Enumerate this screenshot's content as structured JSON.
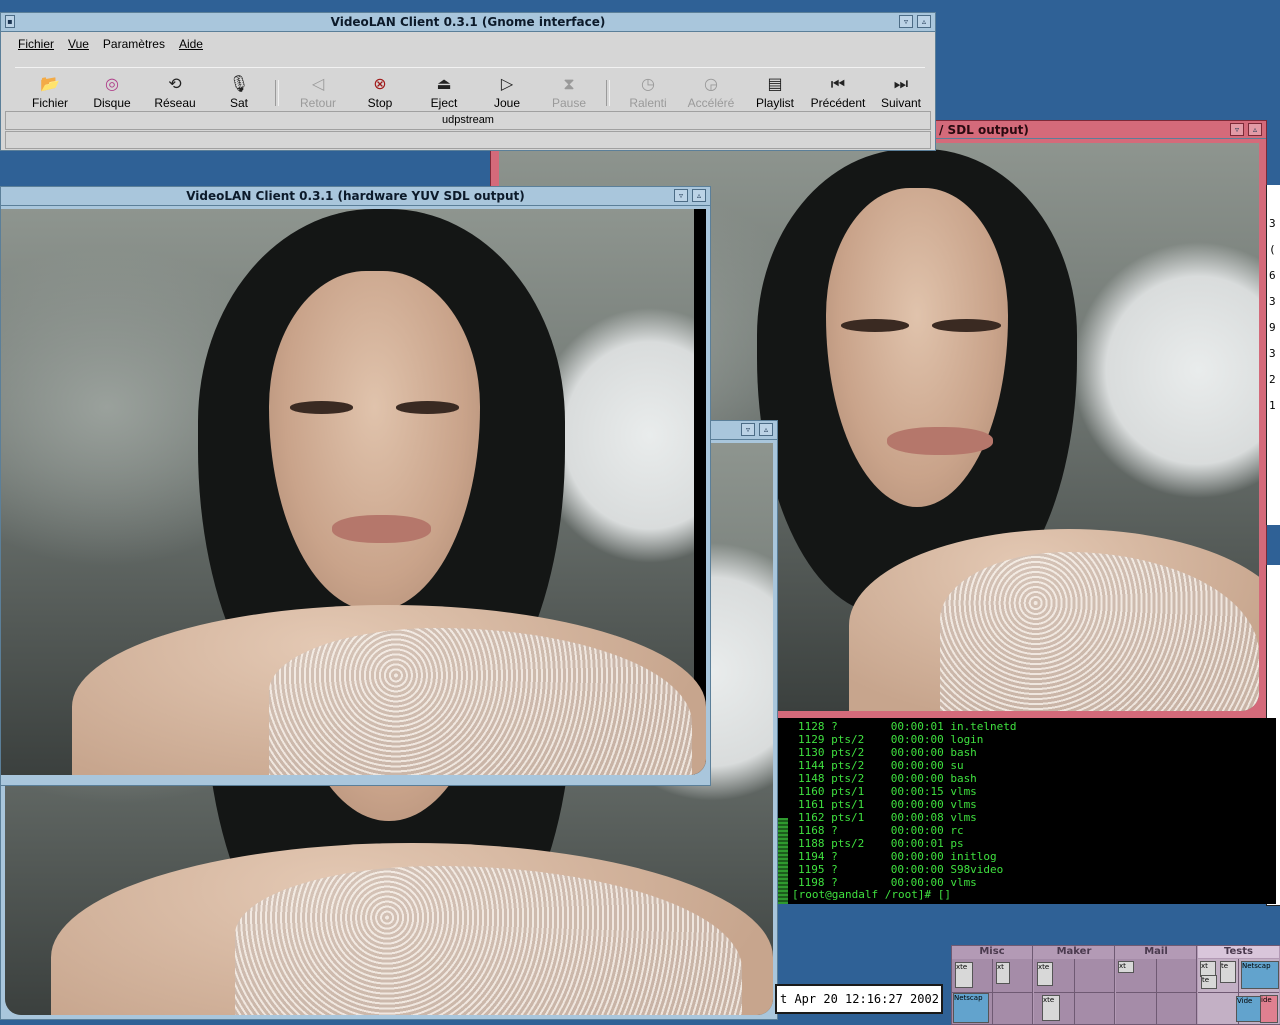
{
  "main_window": {
    "title": "VideoLAN Client 0.3.1 (Gnome interface)",
    "menu": [
      "Fichier",
      "Vue",
      "Paramètres",
      "Aide"
    ],
    "toolbar": [
      {
        "label": "Fichier",
        "icon": "folder-open-icon",
        "enabled": true
      },
      {
        "label": "Disque",
        "icon": "disc-icon",
        "enabled": true
      },
      {
        "label": "Réseau",
        "icon": "network-icon",
        "enabled": true
      },
      {
        "label": "Sat",
        "icon": "microphone-icon",
        "enabled": true
      },
      {
        "label": "Retour",
        "icon": "back-icon",
        "enabled": false
      },
      {
        "label": "Stop",
        "icon": "stop-icon",
        "enabled": true
      },
      {
        "label": "Eject",
        "icon": "eject-icon",
        "enabled": true
      },
      {
        "label": "Joue",
        "icon": "play-icon",
        "enabled": true
      },
      {
        "label": "Pause",
        "icon": "pause-icon",
        "enabled": false
      },
      {
        "label": "Ralenti",
        "icon": "slow-icon",
        "enabled": false
      },
      {
        "label": "Accéléré",
        "icon": "fast-icon",
        "enabled": false
      },
      {
        "label": "Playlist",
        "icon": "playlist-icon",
        "enabled": true
      },
      {
        "label": "Précédent",
        "icon": "prev-icon",
        "enabled": true
      },
      {
        "label": "Suivant",
        "icon": "next-icon",
        "enabled": true
      }
    ],
    "status": "udpstream"
  },
  "video_window_front": {
    "title": "VideoLAN Client 0.3.1 (hardware YUV SDL output)"
  },
  "video_window_back": {
    "title_fragment": "/ SDL output)"
  },
  "terminal": {
    "lines": [
      "1128 ?        00:00:01 in.telnetd",
      "1129 pts/2    00:00:00 login",
      "1130 pts/2    00:00:00 bash",
      "1144 pts/2    00:00:00 su",
      "1148 pts/2    00:00:00 bash",
      "1160 pts/1    00:00:15 vlms",
      "1161 pts/1    00:00:00 vlms",
      "1162 pts/1    00:00:08 vlms",
      "1168 ?        00:00:00 rc",
      "1188 pts/2    00:00:01 ps",
      "1194 ?        00:00:00 initlog",
      "1195 ?        00:00:00 S98video",
      "1198 ?        00:00:00 vlms"
    ],
    "prompt": "[root@gandalf /root]# []"
  },
  "right_edge_chars": [
    "3",
    "(",
    "6",
    "3",
    "9",
    "3",
    "2",
    "1"
  ],
  "clock": {
    "text": "t Apr 20 12:16:27 2002"
  },
  "pager": {
    "desktops": [
      "Misc",
      "Maker",
      "Mail",
      "Tests"
    ],
    "active": "Tests",
    "mini_labels": [
      "xte",
      "xt",
      "xte",
      "xt",
      "xt",
      "te",
      "Netscap",
      "Netscap",
      "xte",
      "Vide",
      "ide",
      "te"
    ]
  },
  "colors": {
    "desktop": "#2f6196",
    "titlebar": "#a9c6dc",
    "pink_frame": "#d46a7a",
    "terminal_text": "#3fe03f"
  }
}
